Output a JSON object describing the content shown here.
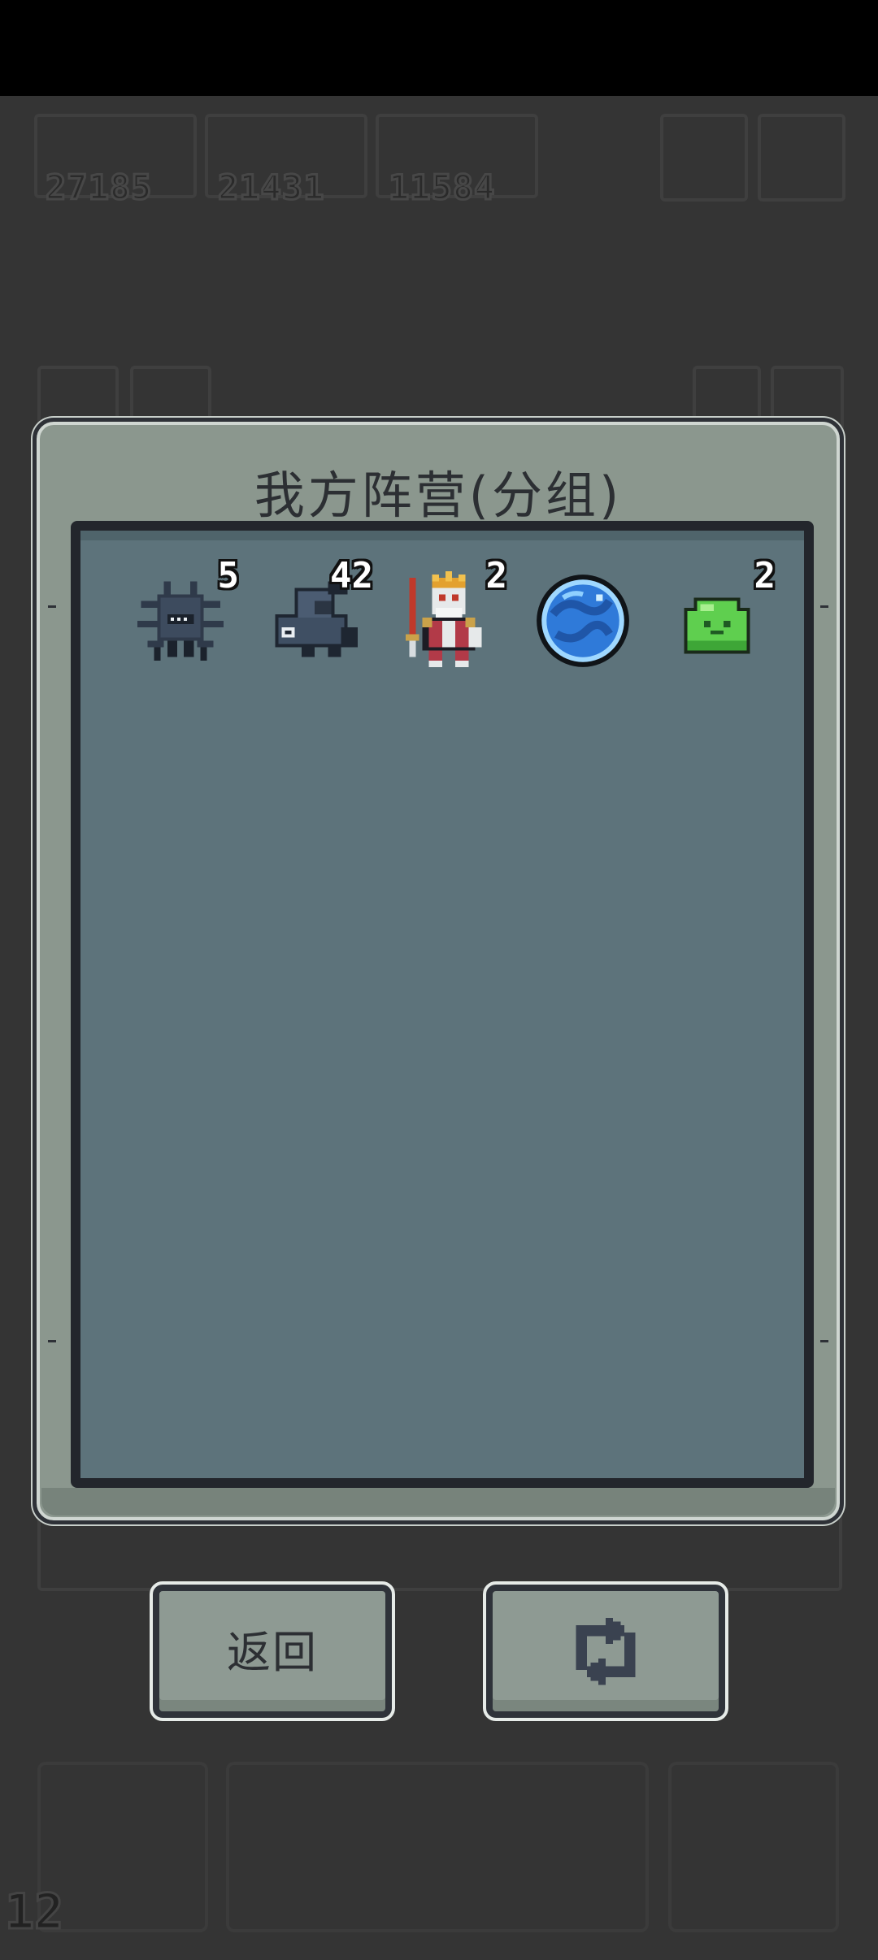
{
  "resources": [
    {
      "value": "27185"
    },
    {
      "value": "21431"
    },
    {
      "value": "11584"
    }
  ],
  "hud": {
    "level": "12"
  },
  "dialog": {
    "title": "我方阵营(分组)",
    "units": [
      {
        "name": "dark-spider-icon",
        "count": "5"
      },
      {
        "name": "shadow-fish-icon",
        "count": "42"
      },
      {
        "name": "skeleton-king-icon",
        "count": "2"
      },
      {
        "name": "water-orb-icon",
        "count": ""
      },
      {
        "name": "green-slime-icon",
        "count": "2"
      }
    ]
  },
  "buttons": {
    "back_label": "返回",
    "refresh_icon": "refresh-icon"
  }
}
